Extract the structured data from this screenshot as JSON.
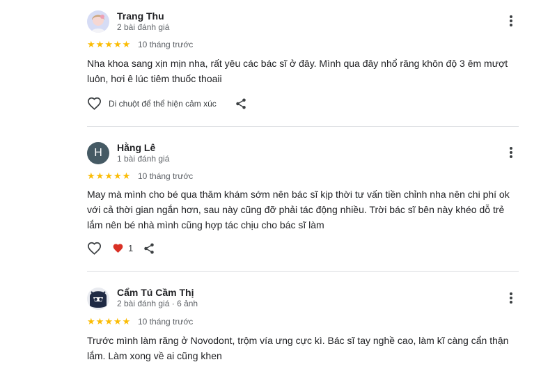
{
  "reviews": [
    {
      "name": "Trang Thu",
      "meta": "2 bài đánh giá",
      "rating": 5,
      "time": "10 tháng trước",
      "text": "Nha khoa sang xịn mịn nha, rất yêu các bác sĩ ở đây. Mình qua đây nhổ răng khôn độ 3 êm mượt luôn, hơi ê lúc tiêm thuốc thoaii",
      "reaction_hint": "Di chuột để thể hiện cảm xúc"
    },
    {
      "name": "Hằng Lê",
      "meta": "1 bài đánh giá",
      "avatar_letter": "H",
      "rating": 5,
      "time": "10 tháng trước",
      "text": "May mà mình cho bé qua thăm khám sớm nên bác sĩ kịp thời tư vấn tiền chỉnh nha nên chi phí ok với cả thời gian ngắn hơn, sau này cũng đỡ phải tác động nhiều. Trời bác sĩ bên này khéo dỗ trẻ lắm nên bé nhà mình cũng hợp tác chịu cho bác sĩ làm",
      "like_count": "1"
    },
    {
      "name": "Cẩm Tú Cầm Thị",
      "meta": "2 bài đánh giá · 6 ảnh",
      "rating": 5,
      "time": "10 tháng trước",
      "text": "Trước mình làm răng ở Novodont, trộm vía ưng cực kì. Bác sĩ tay nghề cao, làm kĩ càng cẩn thận lắm. Làm xong về ai cũng khen"
    }
  ],
  "colors": {
    "star": "#fbbc04",
    "heart_filled": "#d93025",
    "avatar_h": "#455a64"
  },
  "icons": {
    "more": "more-vert-icon",
    "heart_outline": "heart-outline-icon",
    "heart_filled": "heart-filled-icon",
    "share": "share-icon",
    "star": "star-icon"
  }
}
